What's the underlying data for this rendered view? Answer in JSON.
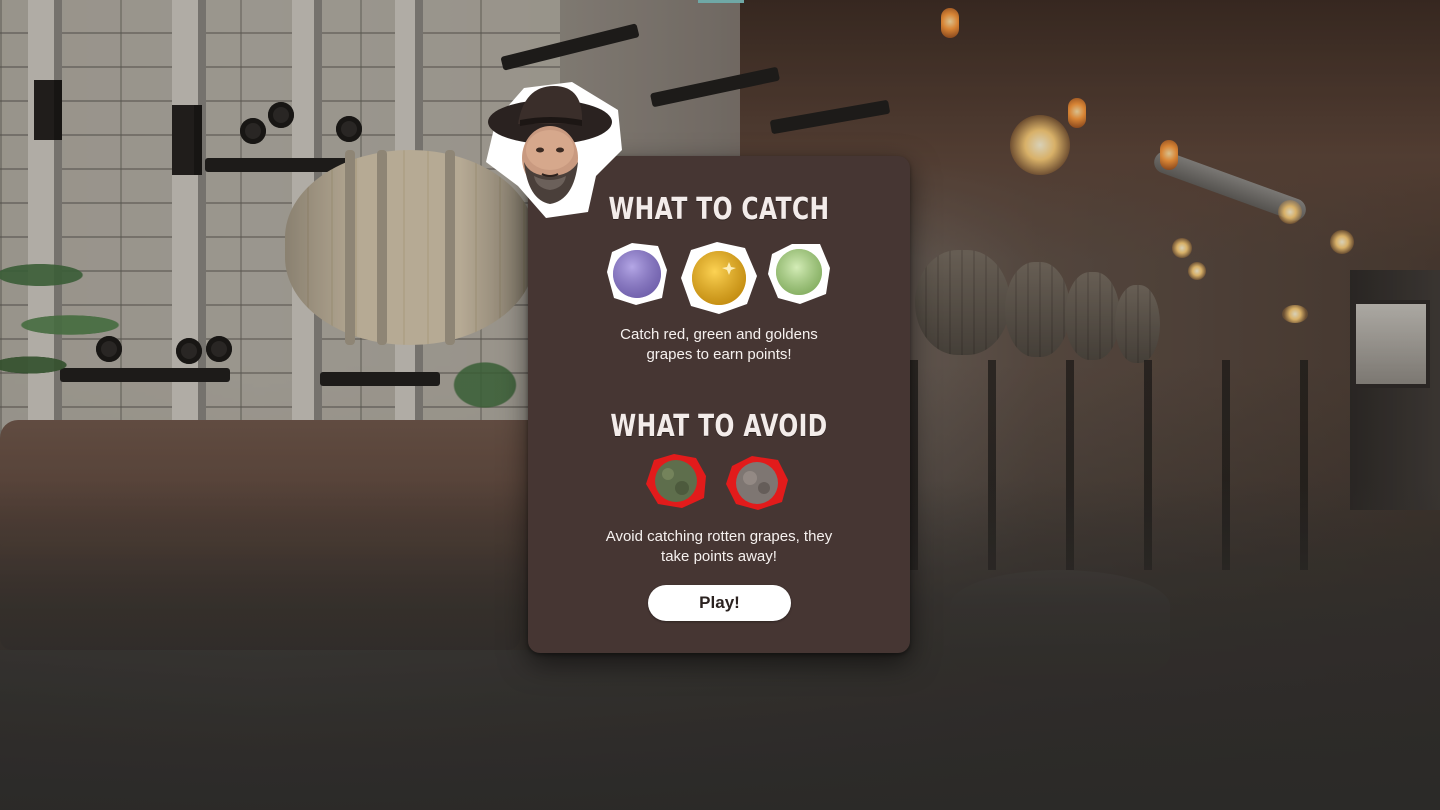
{
  "screen": {
    "name": "game-instructions-overlay"
  },
  "catch_section": {
    "title": "WHAT TO CATCH",
    "description_line1": "Catch red, green and goldens",
    "description_line2": "grapes to earn points!",
    "items": [
      {
        "name": "purple-grape-icon",
        "color": "#8c7bc4"
      },
      {
        "name": "golden-grape-icon",
        "color": "#e8ae1c"
      },
      {
        "name": "green-grape-icon",
        "color": "#a7cf82"
      }
    ]
  },
  "avoid_section": {
    "title": "WHAT TO AVOID",
    "description_line1": "Avoid catching rotten grapes, they",
    "description_line2": "take points away!",
    "items": [
      {
        "name": "rotten-green-grape-icon",
        "border": "#e21b1b"
      },
      {
        "name": "rotten-grey-grape-icon",
        "border": "#e21b1b"
      }
    ]
  },
  "play_button": {
    "label": "Play!"
  },
  "colors": {
    "card_bg": "#463633",
    "text": "#f6f1ef",
    "avoid_border": "#e21b1b",
    "button_bg": "#ffffff"
  },
  "avatar": {
    "icon": "host-portrait-icon"
  }
}
